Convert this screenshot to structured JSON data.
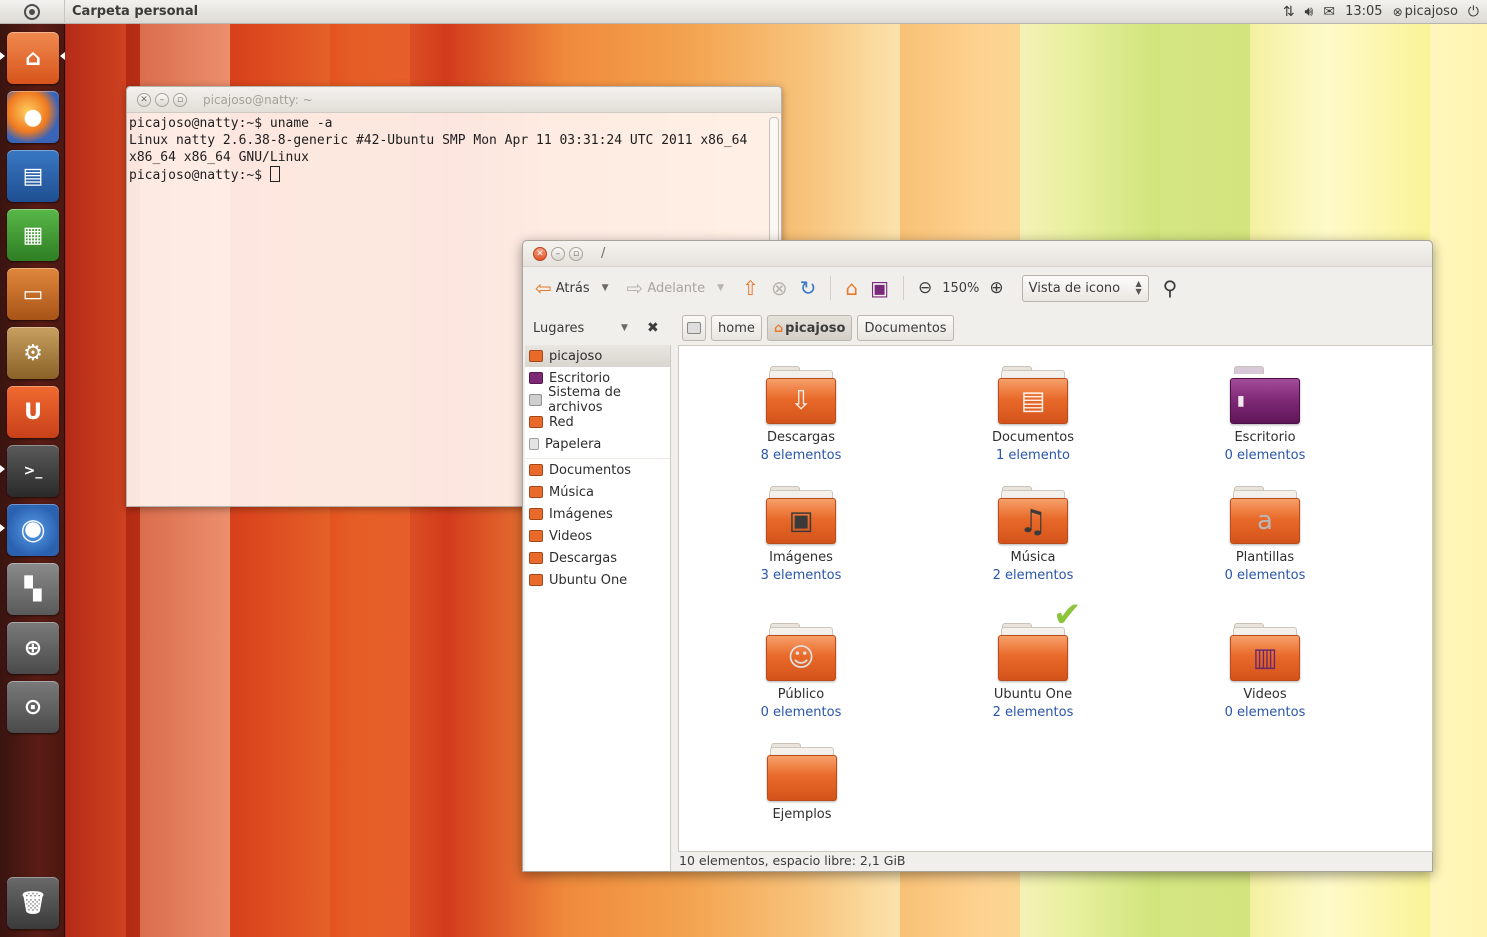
{
  "top_panel": {
    "app_title": "Carpeta personal",
    "time": "13:05",
    "user": "picajoso"
  },
  "terminal": {
    "title": "picajoso@natty: ~",
    "lines": [
      "picajoso@natty:~$ uname -a",
      "Linux natty 2.6.38-8-generic #42-Ubuntu SMP Mon Apr 11 03:31:24 UTC 2011 x86_64",
      "x86_64 x86_64 GNU/Linux",
      "picajoso@natty:~$ "
    ]
  },
  "file_manager": {
    "title": "/",
    "toolbar": {
      "back": "Atrás",
      "forward": "Adelante",
      "zoom": "150%",
      "view_mode": "Vista de icono"
    },
    "places_label": "Lugares",
    "breadcrumbs": [
      "home",
      "picajoso",
      "Documentos"
    ],
    "sidebar": {
      "devices": [
        "picajoso",
        "Escritorio",
        "Sistema de archivos",
        "Red",
        "Papelera"
      ],
      "bookmarks": [
        "Documentos",
        "Música",
        "Imágenes",
        "Videos",
        "Descargas",
        "Ubuntu One"
      ]
    },
    "files": [
      {
        "name": "Descargas",
        "count": "8 elementos",
        "emblem": "⇩"
      },
      {
        "name": "Documentos",
        "count": "1 elemento",
        "emblem": "▤"
      },
      {
        "name": "Escritorio",
        "count": "0 elementos",
        "emblem": "▮"
      },
      {
        "name": "Imágenes",
        "count": "3 elementos",
        "emblem": "▣"
      },
      {
        "name": "Música",
        "count": "2 elementos",
        "emblem": "♫"
      },
      {
        "name": "Plantillas",
        "count": "0 elementos",
        "emblem": "a"
      },
      {
        "name": "Público",
        "count": "0 elementos",
        "emblem": "☺"
      },
      {
        "name": "Ubuntu One",
        "count": "2 elementos",
        "emblem": ""
      },
      {
        "name": "Videos",
        "count": "0 elementos",
        "emblem": "▥"
      },
      {
        "name": "Ejemplos",
        "count": "",
        "emblem": ""
      }
    ],
    "status": "10 elementos, espacio libre: 2,1 GiB"
  },
  "colors": {
    "folder_orange": "#e96a2a",
    "link_blue": "#2a55a8",
    "launcher_bg": "#4a1812"
  }
}
